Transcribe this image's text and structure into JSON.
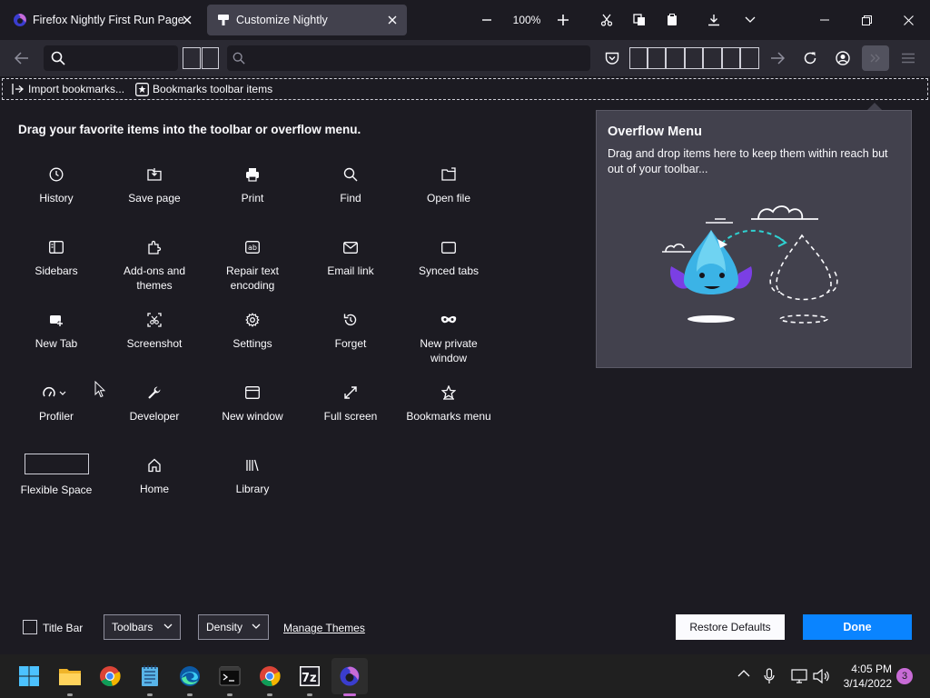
{
  "tabs": [
    {
      "title": "Firefox Nightly First Run Page",
      "active": false
    },
    {
      "title": "Customize Nightly",
      "active": true
    }
  ],
  "toolbar": {
    "zoom_level": "100%"
  },
  "bookmarks_bar": {
    "items": [
      {
        "label": "Import bookmarks...",
        "icon": "import-icon"
      },
      {
        "label": "Bookmarks toolbar items",
        "icon": "star-icon"
      }
    ]
  },
  "palette": {
    "title": "Drag your favorite items into the toolbar or overflow menu.",
    "items": [
      {
        "label": "History",
        "icon": "clock-icon"
      },
      {
        "label": "Save page",
        "icon": "save-page-icon"
      },
      {
        "label": "Print",
        "icon": "printer-icon"
      },
      {
        "label": "Find",
        "icon": "search-icon"
      },
      {
        "label": "Open file",
        "icon": "folder-open-icon"
      },
      {
        "label": "Sidebars",
        "icon": "sidebar-icon"
      },
      {
        "label": "Add-ons and themes",
        "icon": "puzzle-icon"
      },
      {
        "label": "Repair text encoding",
        "icon": "text-encoding-icon"
      },
      {
        "label": "Email link",
        "icon": "envelope-icon"
      },
      {
        "label": "Synced tabs",
        "icon": "synced-tabs-icon"
      },
      {
        "label": "New Tab",
        "icon": "new-tab-icon"
      },
      {
        "label": "Screenshot",
        "icon": "screenshot-icon"
      },
      {
        "label": "Settings",
        "icon": "gear-icon"
      },
      {
        "label": "Forget",
        "icon": "forget-icon"
      },
      {
        "label": "New private window",
        "icon": "mask-icon"
      },
      {
        "label": "Profiler",
        "icon": "profiler-icon"
      },
      {
        "label": "Developer",
        "icon": "wrench-icon"
      },
      {
        "label": "New window",
        "icon": "window-icon"
      },
      {
        "label": "Full screen",
        "icon": "fullscreen-icon"
      },
      {
        "label": "Bookmarks menu",
        "icon": "bookmark-star-icon"
      },
      {
        "label": "Flexible Space",
        "icon": "flexible-space-box"
      },
      {
        "label": "Home",
        "icon": "home-icon"
      },
      {
        "label": "Library",
        "icon": "library-icon"
      }
    ]
  },
  "overflow": {
    "title": "Overflow Menu",
    "description": "Drag and drop items here to keep them within reach but out of your toolbar..."
  },
  "footer": {
    "title_bar_label": "Title Bar",
    "title_bar_checked": false,
    "toolbars_label": "Toolbars",
    "density_label": "Density",
    "manage_themes_label": "Manage Themes",
    "restore_label": "Restore Defaults",
    "done_label": "Done"
  },
  "taskbar": {
    "apps": [
      "windows-start-icon",
      "file-explorer-icon",
      "chrome-icon",
      "notepad-icon",
      "edge-icon",
      "terminal-icon",
      "chrome-icon",
      "7zip-icon",
      "firefox-nightly-icon"
    ],
    "time": "4:05 PM",
    "date": "3/14/2022",
    "notification_count": "3"
  },
  "colors": {
    "background": "#1c1b22",
    "toolbar": "#2b2a33",
    "panel": "#42414d",
    "accent": "#0a84ff",
    "text": "#fbfbfe"
  }
}
